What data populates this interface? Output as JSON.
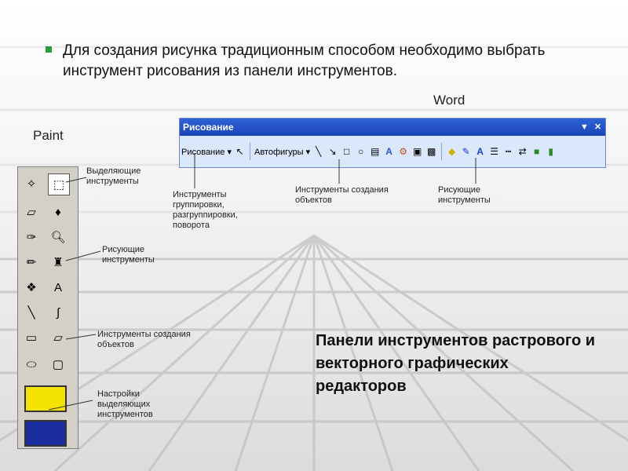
{
  "headline": "Для создания рисунка традиционным способом необходимо выбрать инструмент рисования из панели инструментов.",
  "labels": {
    "word": "Word",
    "paint": "Paint"
  },
  "word_toolbar": {
    "title": "Рисование",
    "menu_draw": "Рисование ▾",
    "menu_autoshapes": "Автофигуры ▾"
  },
  "annotations": {
    "group": "Инструменты группировки, разгруппировки, поворота",
    "create_word": "Инструменты создания объектов",
    "draw_word": "Рисующие инструменты",
    "select": "Выделяющие инструменты",
    "draw_paint": "Рисующие инструменты",
    "create_paint": "Инструменты создания объектов",
    "settings": "Настройки выделяющих инструментов"
  },
  "caption": "Панели инструментов растрового и векторного графических редакторов",
  "colors": {
    "bullet": "#2c9a3e",
    "titlebar": "#2d63d6",
    "toolbar": "#dbe7fb"
  }
}
